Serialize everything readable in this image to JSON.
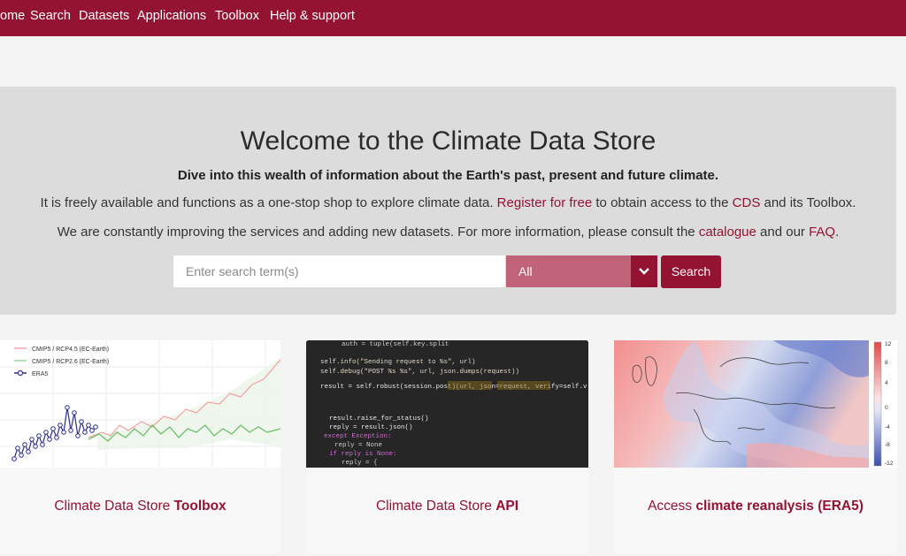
{
  "nav": {
    "items": [
      {
        "label": "ome"
      },
      {
        "label": "Search"
      },
      {
        "label": "Datasets"
      },
      {
        "label": "Applications"
      },
      {
        "label": "Toolbox"
      },
      {
        "label": "Help & support"
      }
    ]
  },
  "hero": {
    "title": "Welcome to the Climate Data Store",
    "subtitle": "Dive into this wealth of information about the Earth's past, present and future climate.",
    "line1_pre": "It is freely available and functions  as a one-stop shop to explore climate data. ",
    "line1_link1": "Register for free",
    "line1_mid": " to obtain access to the ",
    "line1_link2": "CDS",
    "line1_post": " and its Toolbox.",
    "line2_pre": "We are constantly improving the services and adding new datasets. For more information, please consult the ",
    "line2_link1": "catalogue",
    "line2_mid": " and our ",
    "line2_link2": "FAQ",
    "line2_post": "."
  },
  "search": {
    "placeholder": "Enter search term(s)",
    "value": "",
    "select_value": "All",
    "button_label": "Search"
  },
  "cards": [
    {
      "label_pre": "Climate Data Store ",
      "label_bold": "Toolbox",
      "legend": [
        "CMIP5 / RCP4.5 (EC-Earth)",
        "CMIP5 / RCP2.6 (EC-Earth)",
        "ERA5"
      ]
    },
    {
      "label_pre": "Climate Data Store ",
      "label_bold": "API",
      "code_lines": [
        "auth = tuple(self.key.split",
        "self.info(\"Sending request to %s\", url)",
        "self.debug(\"POST %s %s\", url, json.dumps(request))",
        "result = self.robust(session.post)(url, json=request, verify=self.v",
        "result.raise_for_status()",
        "reply = result.json()",
        "except Exception:",
        "reply = None",
        "if reply is None:",
        "reply = {"
      ]
    },
    {
      "label_pre": "Access ",
      "label_bold": "climate reanalysis (ERA5)",
      "colorbar_ticks": [
        "12",
        "8",
        "4",
        "0",
        "-4",
        "-8",
        "-12"
      ]
    }
  ],
  "colors": {
    "brand": "#941333",
    "select_bg": "#c06278",
    "hero_bg": "#dcdcdc"
  }
}
